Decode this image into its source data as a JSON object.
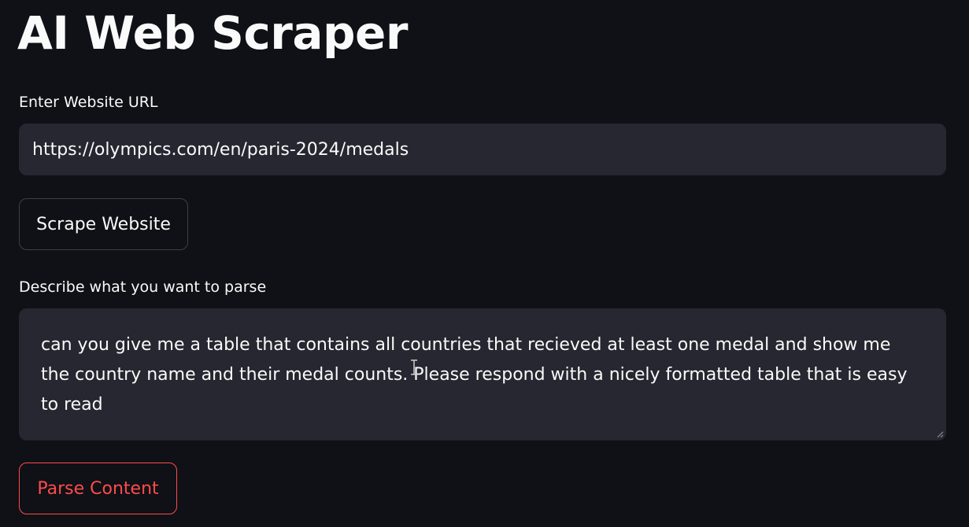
{
  "header": {
    "title": "AI Web Scraper"
  },
  "url_field": {
    "label": "Enter Website URL",
    "value": "https://olympics.com/en/paris-2024/medals"
  },
  "scrape_button": {
    "label": "Scrape Website"
  },
  "parse_field": {
    "label": "Describe what you want to parse",
    "value": "can you give me a table that contains all countries that recieved at least one medal and show me the country name and their medal counts. Please respond with a nicely formatted table that is easy to read"
  },
  "parse_button": {
    "label": "Parse Content"
  },
  "colors": {
    "background": "#0f1116",
    "field_background": "#262730",
    "text": "#fafafa",
    "accent": "#ff4b4b"
  },
  "icons": {
    "resize_handle": "resize-handle-icon",
    "text_cursor": "text-cursor-icon"
  }
}
